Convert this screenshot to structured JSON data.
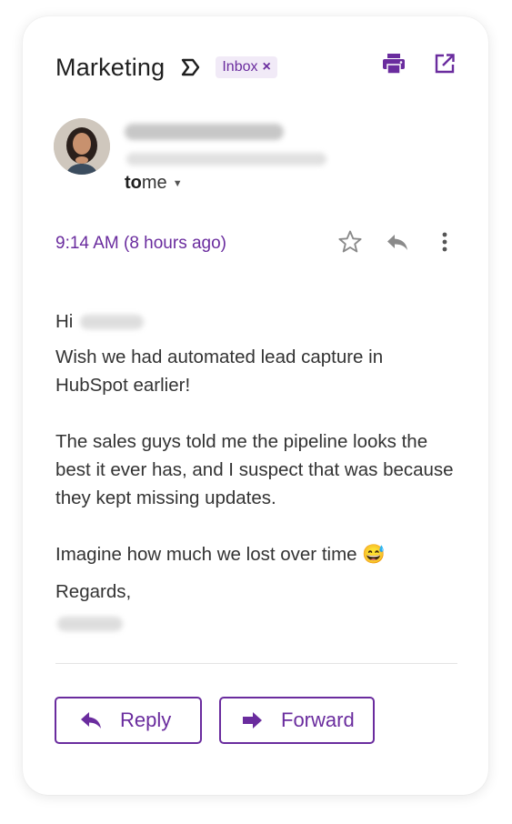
{
  "email": {
    "subject": "Marketing",
    "label": {
      "name": "Inbox",
      "remove_glyph": "×"
    },
    "recipient_prefix": "to",
    "recipient": "me",
    "timestamp": "9:14 AM (8 hours ago)",
    "body": {
      "greeting": "Hi",
      "paragraph_1": "Wish we had automated lead capture in HubSpot earlier!",
      "paragraph_2": "The sales guys told me the pipeline looks the best it ever has, and I suspect that was because they kept missing updates.",
      "paragraph_3": "Imagine how much we lost over time 😅",
      "closing": "Regards,"
    }
  },
  "actions": {
    "reply_label": "Reply",
    "forward_label": "Forward"
  },
  "icons": {
    "important": "important-marker-icon",
    "print": "print-icon",
    "open_new_window": "open-in-new-icon",
    "star": "star-icon",
    "reply": "reply-icon",
    "more": "more-vertical-icon",
    "reply_button": "reply-arrow-icon",
    "forward_button": "forward-arrow-icon"
  },
  "colors": {
    "accent": "#6a2c9e",
    "label_bg": "#f1eaf7",
    "text": "#333333",
    "icon_gray": "#8a8a8a"
  }
}
